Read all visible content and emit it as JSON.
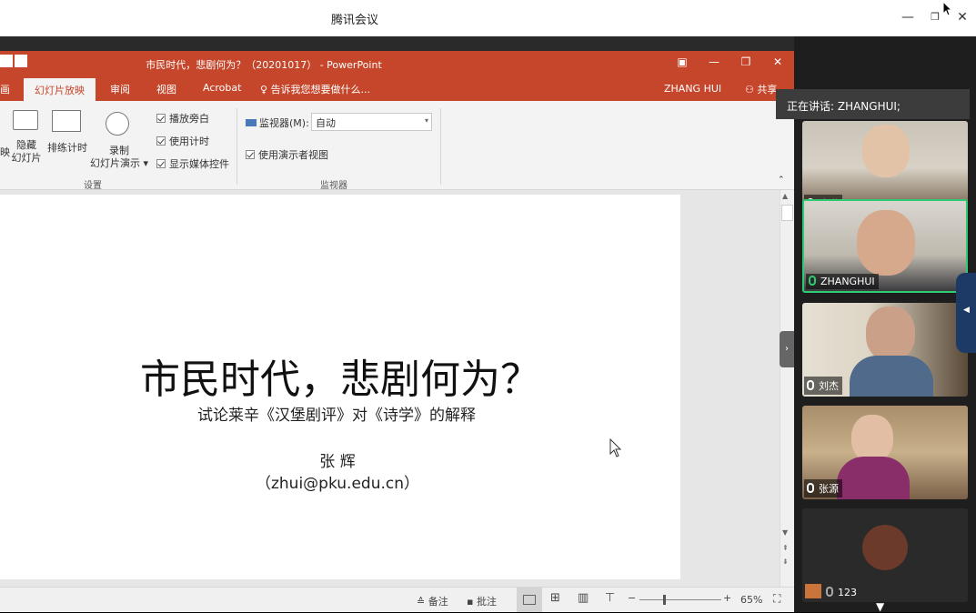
{
  "meeting": {
    "window_title": "腾讯会议",
    "speaking_label": "正在讲话: ZHANGHUI;"
  },
  "ppt": {
    "doc_title": "市民时代，悲剧何为？（20201017） - PowerPoint",
    "tabs": [
      "画",
      "幻灯片放映",
      "审阅",
      "视图",
      "Acrobat"
    ],
    "active_tab": "幻灯片放映",
    "tell_me": "告诉我您想要做什么...",
    "user": "ZHANG HUI",
    "share": "共享",
    "ribbon": {
      "hide_slide": [
        "隐藏",
        "幻灯片"
      ],
      "rehearse": "排练计时",
      "record": [
        "录制",
        "幻灯片演示"
      ],
      "cb_narration": "播放旁白",
      "cb_timing": "使用计时",
      "cb_media": "显示媒体控件",
      "group_setup": "设置",
      "monitor_label": "监视器(M):",
      "monitor_value": "自动",
      "cb_presenter": "使用演示者视图",
      "group_monitor": "监视器",
      "left_cut": "映"
    },
    "slide": {
      "title": "市民时代，悲剧何为？",
      "subtitle": "试论莱辛《汉堡剧评》对《诗学》的解释",
      "author": "张 辉",
      "email": "（zhui@pku.edu.cn）"
    },
    "status": {
      "notes": "备注",
      "comments": "批注",
      "zoom": "65%"
    }
  },
  "participants": [
    {
      "name": "陈琳",
      "active": false
    },
    {
      "name": "ZHANGHUI",
      "active": true
    },
    {
      "name": "刘杰",
      "active": false
    },
    {
      "name": "张源",
      "active": false
    },
    {
      "name": "123",
      "active": false
    }
  ]
}
